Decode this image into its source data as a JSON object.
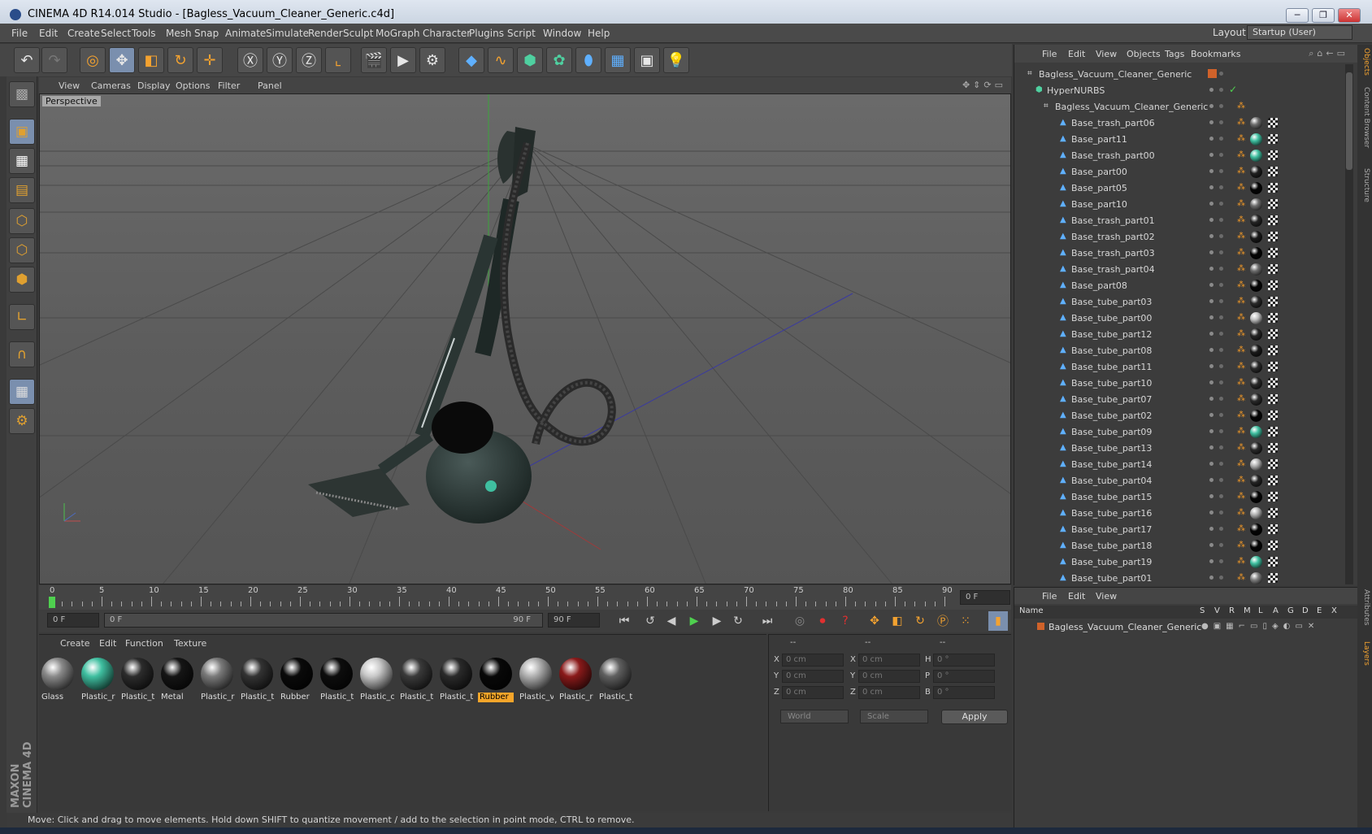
{
  "window": {
    "title": "CINEMA 4D R14.014 Studio - [Bagless_Vacuum_Cleaner_Generic.c4d]",
    "min": "─",
    "max": "❐",
    "close": "✕"
  },
  "menubar": {
    "items": [
      "File",
      "Edit",
      "Create",
      "Select",
      "Tools",
      "Mesh",
      "Snap",
      "Animate",
      "Simulate",
      "Render",
      "Sculpt",
      "MoGraph",
      "Character",
      "Plugins",
      "Script",
      "Window",
      "Help"
    ],
    "layout_label": "Layout:",
    "layout_value": "Startup (User)"
  },
  "viewport": {
    "menu": [
      "View",
      "Cameras",
      "Display",
      "Options",
      "Filter",
      "Panel"
    ],
    "label": "Perspective"
  },
  "timeline": {
    "ticks": [
      "0",
      "5",
      "10",
      "15",
      "20",
      "25",
      "30",
      "35",
      "40",
      "45",
      "50",
      "55",
      "60",
      "65",
      "70",
      "75",
      "80",
      "85",
      "90"
    ],
    "frame_display": "0 F",
    "start_frame": "0 F",
    "range_start": "0 F",
    "range_end": "90 F",
    "end_frame": "90 F"
  },
  "materials": {
    "menu": [
      "Create",
      "Edit",
      "Function",
      "Texture"
    ],
    "items": [
      {
        "label": "Glass",
        "color": "#8a8a8a"
      },
      {
        "label": "Plastic_r",
        "color": "#3fbfa0"
      },
      {
        "label": "Plastic_t",
        "color": "#2c2c2c"
      },
      {
        "label": "Metal",
        "color": "#151515"
      },
      {
        "label": "Plastic_r",
        "color": "#7a7a7a"
      },
      {
        "label": "Plastic_t",
        "color": "#333333"
      },
      {
        "label": "Rubber",
        "color": "#0a0a0a"
      },
      {
        "label": "Plastic_t",
        "color": "#0d0d0d"
      },
      {
        "label": "Plastic_c",
        "color": "#c8c8c8"
      },
      {
        "label": "Plastic_t",
        "color": "#3a3a3a"
      },
      {
        "label": "Plastic_t",
        "color": "#2a2a2a"
      },
      {
        "label": "Rubber",
        "color": "#080808"
      },
      {
        "label": "Plastic_v",
        "color": "#b0b0b0"
      },
      {
        "label": "Plastic_r",
        "color": "#8a1a1a"
      },
      {
        "label": "Plastic_t",
        "color": "#606060"
      }
    ],
    "selected_index": 11
  },
  "coords": {
    "headers": [
      "--",
      "--",
      "--"
    ],
    "rows": [
      {
        "a": "X",
        "av": "0 cm",
        "b": "X",
        "bv": "0 cm",
        "c": "H",
        "cv": "0 °"
      },
      {
        "a": "Y",
        "av": "0 cm",
        "b": "Y",
        "bv": "0 cm",
        "c": "P",
        "cv": "0 °"
      },
      {
        "a": "Z",
        "av": "0 cm",
        "b": "Z",
        "bv": "0 cm",
        "c": "B",
        "cv": "0 °"
      }
    ],
    "world": "World",
    "scale": "Scale",
    "apply": "Apply"
  },
  "status": "Move: Click and drag to move elements. Hold down SHIFT to quantize movement / add to the selection in point mode, CTRL to remove.",
  "brand": "MAXON CINEMA 4D",
  "objects": {
    "menu": [
      "File",
      "Edit",
      "View",
      "Objects",
      "Tags",
      "Bookmarks"
    ],
    "root": "Bagless_Vacuum_Cleaner_Generic",
    "hypernurbs": "HyperNURBS",
    "group": "Bagless_Vacuum_Cleaner_Generic",
    "items": [
      {
        "name": "Base_trash_part06",
        "tag": "#6d6d6d"
      },
      {
        "name": "Base_part11",
        "tag": "#3fbfa0"
      },
      {
        "name": "Base_trash_part00",
        "tag": "#3fbfa0"
      },
      {
        "name": "Base_part00",
        "tag": "#202020"
      },
      {
        "name": "Base_part05",
        "tag": "#050505"
      },
      {
        "name": "Base_part10",
        "tag": "#6d6d6d"
      },
      {
        "name": "Base_trash_part01",
        "tag": "#252525"
      },
      {
        "name": "Base_trash_part02",
        "tag": "#1a1a1a"
      },
      {
        "name": "Base_trash_part03",
        "tag": "#050505"
      },
      {
        "name": "Base_trash_part04",
        "tag": "#6d6d6d"
      },
      {
        "name": "Base_part08",
        "tag": "#050505"
      },
      {
        "name": "Base_tube_part03",
        "tag": "#2a2a2a"
      },
      {
        "name": "Base_tube_part00",
        "tag": "#c0c0c0"
      },
      {
        "name": "Base_tube_part12",
        "tag": "#252525"
      },
      {
        "name": "Base_tube_part08",
        "tag": "#1a1a1a"
      },
      {
        "name": "Base_tube_part11",
        "tag": "#2a2a2a"
      },
      {
        "name": "Base_tube_part10",
        "tag": "#2a2a2a"
      },
      {
        "name": "Base_tube_part07",
        "tag": "#2a2a2a"
      },
      {
        "name": "Base_tube_part02",
        "tag": "#050505"
      },
      {
        "name": "Base_tube_part09",
        "tag": "#3fbfa0"
      },
      {
        "name": "Base_tube_part13",
        "tag": "#2a2a2a"
      },
      {
        "name": "Base_tube_part14",
        "tag": "#b0b0b0"
      },
      {
        "name": "Base_tube_part04",
        "tag": "#252525"
      },
      {
        "name": "Base_tube_part15",
        "tag": "#050505"
      },
      {
        "name": "Base_tube_part16",
        "tag": "#b0b0b0"
      },
      {
        "name": "Base_tube_part17",
        "tag": "#050505"
      },
      {
        "name": "Base_tube_part18",
        "tag": "#050505"
      },
      {
        "name": "Base_tube_part19",
        "tag": "#3fbfa0"
      },
      {
        "name": "Base_tube_part01",
        "tag": "#808080"
      }
    ]
  },
  "layers": {
    "menu": [
      "File",
      "Edit",
      "View"
    ],
    "columns": [
      "Name",
      "S",
      "V",
      "R",
      "M",
      "L",
      "A",
      "G",
      "D",
      "E",
      "X"
    ],
    "item": "Bagless_Vacuum_Cleaner_Generic"
  },
  "sidetabs": [
    "Objects",
    "Content Browser",
    "Structure",
    "Attributes",
    "Layers"
  ]
}
